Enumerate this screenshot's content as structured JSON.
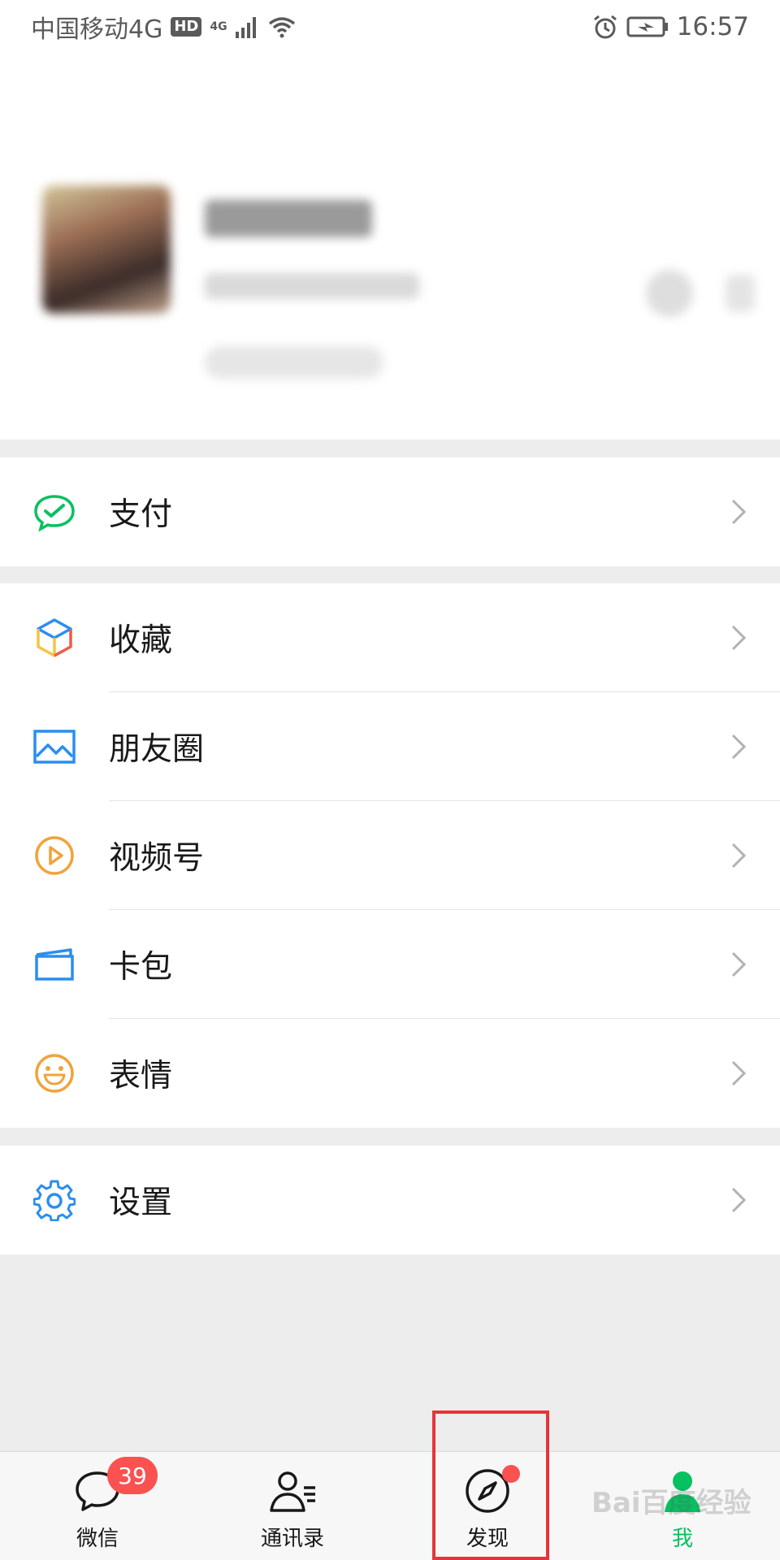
{
  "status_bar": {
    "carrier": "中国移动4G",
    "hd": "HD",
    "net": "4G",
    "time": "16:57"
  },
  "profile": {
    "name": "",
    "id": ""
  },
  "menu": {
    "pay": "支付",
    "favorites": "收藏",
    "moments": "朋友圈",
    "channels": "视频号",
    "cards": "卡包",
    "stickers": "表情",
    "settings": "设置"
  },
  "tabs": [
    {
      "label": "微信",
      "badge": "39"
    },
    {
      "label": "通讯录"
    },
    {
      "label": "发现"
    },
    {
      "label": "我"
    }
  ],
  "colors": {
    "accent": "#07c160",
    "badge": "#fa5151",
    "highlight": "#e8333a"
  },
  "watermark": "Bai百度经验"
}
